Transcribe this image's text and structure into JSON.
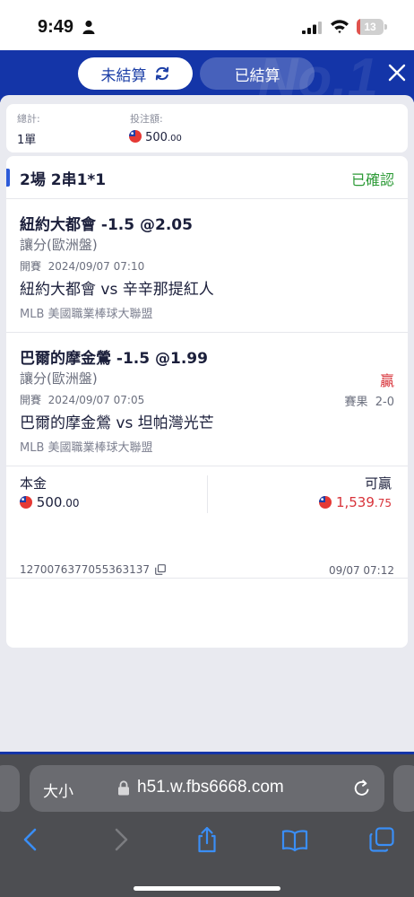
{
  "status_bar": {
    "time": "9:49",
    "battery_level": "13",
    "battery_fraction": 0.13,
    "battery_color": "#e0524d",
    "icons": [
      "person-icon",
      "signal-icon",
      "wifi-icon",
      "battery-icon"
    ]
  },
  "header": {
    "tab_unsettled": "未結算",
    "tab_settled": "已結算",
    "brand_color": "#1435a8",
    "icons": [
      "refresh-icon",
      "close-icon"
    ]
  },
  "summary": {
    "total_label": "總計:",
    "total_value": "1單",
    "stake_label": "投注額:",
    "stake_value": "500",
    "stake_decimal": ".00"
  },
  "bet": {
    "title": "2場 2串1*1",
    "status": "已確認",
    "status_color": "#2c9a36",
    "legs": [
      {
        "selection": "紐約大都會 -1.5 @2.05",
        "market": "讓分(歐洲盤)",
        "kickoff_label": "開賽",
        "kickoff_time": "2024/09/07 07:10",
        "match": "紐約大都會 vs 辛辛那提紅人",
        "league": "MLB 美國職業棒球大聯盟"
      },
      {
        "selection": "巴爾的摩金鶯 -1.5 @1.99",
        "market": "讓分(歐洲盤)",
        "kickoff_label": "開賽",
        "kickoff_time": "2024/09/07 07:05",
        "result": "贏",
        "score_label": "賽果",
        "score": "2-0",
        "match": "巴爾的摩金鶯 vs 坦帕灣光芒",
        "league": "MLB 美國職業棒球大聯盟"
      }
    ],
    "stake_label": "本金",
    "stake_value": "500",
    "stake_decimal": ".00",
    "payout_label": "可贏",
    "payout_value": "1,539",
    "payout_decimal": ".75",
    "payout_color": "#d8333a",
    "ticket_id": "1270076377055363137",
    "placed_time": "09/07 07:12"
  },
  "browser": {
    "text_size_label": "大小",
    "url": "h51.w.fbs6668.com",
    "icons": [
      "lock-icon",
      "reload-icon",
      "back-icon",
      "forward-icon",
      "share-icon",
      "bookmarks-icon",
      "tabs-icon"
    ]
  }
}
